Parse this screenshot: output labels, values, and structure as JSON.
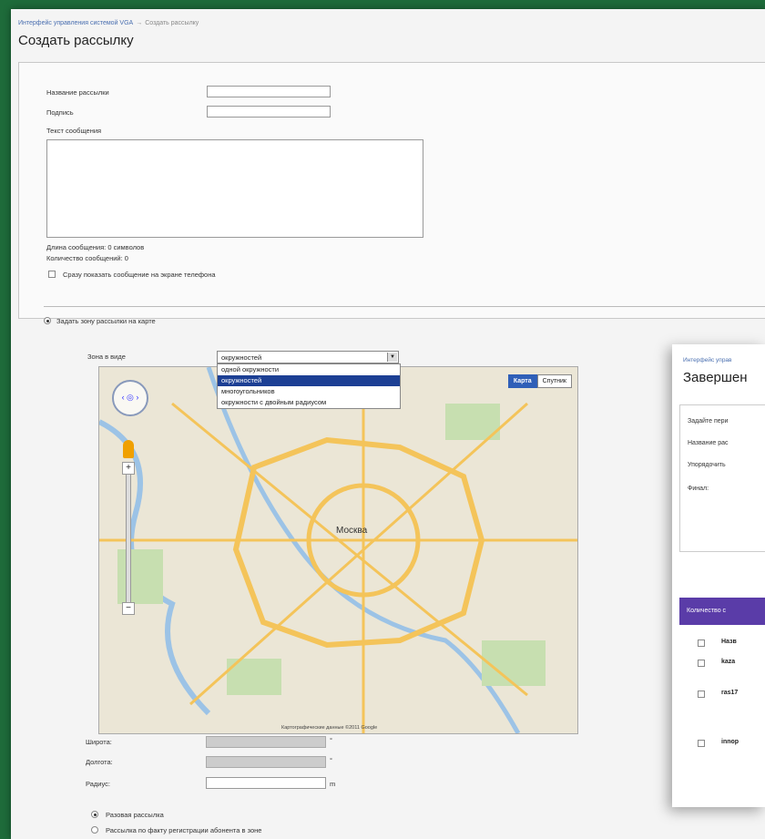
{
  "breadcrumb": {
    "parent": "Интерфейс управления системой VGA",
    "separator": "→",
    "current": "Создать рассылку"
  },
  "page_title": "Создать рассылку",
  "form": {
    "name_label": "Название рассылки",
    "signature_label": "Подпись",
    "message_label": "Текст сообщения",
    "length_text": "Длина сообщения: 0 символов",
    "count_text": "Количество сообщений: 0",
    "show_on_screen_label": "Сразу показать сообщение на экране телефона"
  },
  "zone": {
    "radio_label": "Задать зону рассылки на карте",
    "zone_type_label": "Зона в виде",
    "selected": "окружностей",
    "options": [
      "одной окружности",
      "окружностей",
      "многоугольников",
      "окружности с двойным радиусом"
    ]
  },
  "map": {
    "btn_map": "Карта",
    "btn_satellite": "Спутник",
    "city": "Москва",
    "attribution": "Картографические данные ©2011 Google",
    "accent": "#2f5fb8"
  },
  "coords": {
    "lat_label": "Широта:",
    "lon_label": "Долгота:",
    "radius_label": "Радиус:",
    "deg": "°",
    "unit": "m"
  },
  "mode": {
    "one_time": "Разовая рассылка",
    "on_register": "Рассылка по факту регистрации абонента в зоне"
  },
  "right_panel": {
    "breadcrumb": "Интерфейс управ",
    "title": "Завершен",
    "labels": [
      "Задайте пери",
      "Название рас",
      "Упорядочить",
      "Финал:"
    ],
    "bar": "Количество с",
    "rows": [
      "Назв",
      "kaza",
      "ras17",
      "innop"
    ]
  }
}
